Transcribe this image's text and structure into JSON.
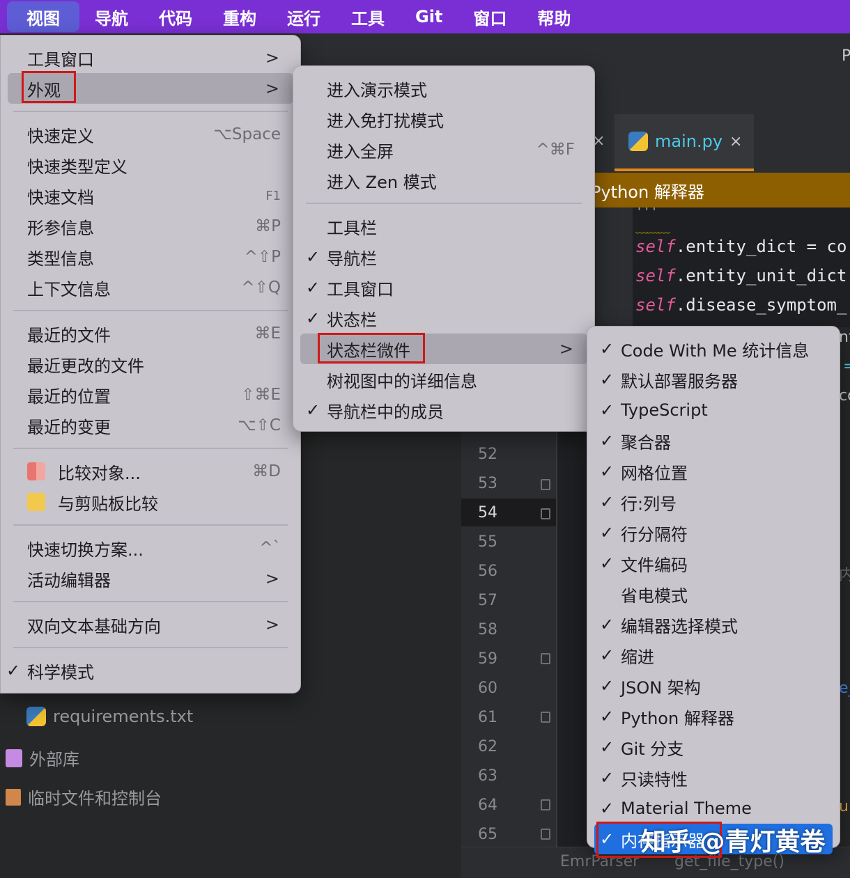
{
  "menubar": {
    "items": [
      "视图",
      "导航",
      "代码",
      "重构",
      "运行",
      "工具",
      "Git",
      "窗口",
      "帮助"
    ]
  },
  "editor": {
    "tab_label": "main.py",
    "tab_close": "×",
    "prev_tab_close": "×",
    "interpreter_banner": "Python 解释器",
    "docstring_quotes": "'''",
    "code_lines": [
      {
        "kw": "self",
        "rest": ".entity_dict = co"
      },
      {
        "kw": "self",
        "rest": ".entity_unit_dict"
      },
      {
        "kw": "self",
        "rest": ".disease_symptom_"
      }
    ],
    "line_numbers": [
      "52",
      "53",
      "54",
      "55",
      "56",
      "57",
      "58",
      "59",
      "60",
      "61",
      "62",
      "63",
      "64",
      "65"
    ],
    "current_line": "54",
    "breadcrumb_left": "EmrParser",
    "breadcrumb_right": "get_file_type()",
    "edge_chars": [
      "P",
      "nt",
      "=",
      "co",
      "内",
      "e_",
      "u"
    ]
  },
  "tree": {
    "items": [
      "requirements.txt",
      "外部库",
      "临时文件和控制台"
    ]
  },
  "view_menu": {
    "items": [
      {
        "label": "工具窗口",
        "arrow": ">"
      },
      {
        "label": "外观",
        "arrow": ">"
      },
      {
        "label": "快速定义",
        "shortcut": "⌥Space"
      },
      {
        "label": "快速类型定义"
      },
      {
        "label": "快速文档",
        "shortcut": "F1"
      },
      {
        "label": "形参信息",
        "shortcut": "⌘P"
      },
      {
        "label": "类型信息",
        "shortcut": "^⇧P"
      },
      {
        "label": "上下文信息",
        "shortcut": "^⇧Q"
      },
      {
        "label": "最近的文件",
        "shortcut": "⌘E"
      },
      {
        "label": "最近更改的文件"
      },
      {
        "label": "最近的位置",
        "shortcut": "⇧⌘E"
      },
      {
        "label": "最近的变更",
        "shortcut": "⌥⇧C"
      },
      {
        "label": "比较对象...",
        "shortcut": "⌘D"
      },
      {
        "label": "与剪贴板比较"
      },
      {
        "label": "快速切换方案...",
        "shortcut": "^`"
      },
      {
        "label": "活动编辑器",
        "arrow": ">"
      },
      {
        "label": "双向文本基础方向",
        "arrow": ">"
      },
      {
        "label": "科学模式",
        "check": "✓"
      }
    ]
  },
  "appearance_menu": {
    "items": [
      {
        "label": "进入演示模式"
      },
      {
        "label": "进入免打扰模式"
      },
      {
        "label": "进入全屏",
        "shortcut": "^⌘F"
      },
      {
        "label": "进入 Zen 模式"
      },
      {
        "label": "工具栏"
      },
      {
        "label": "导航栏",
        "check": "✓"
      },
      {
        "label": "工具窗口",
        "check": "✓"
      },
      {
        "label": "状态栏",
        "check": "✓"
      },
      {
        "label": "状态栏微件",
        "arrow": ">"
      },
      {
        "label": "树视图中的详细信息"
      },
      {
        "label": "导航栏中的成员",
        "check": "✓"
      }
    ]
  },
  "widgets_menu": {
    "items": [
      {
        "label": "Code With Me 统计信息",
        "check": "✓"
      },
      {
        "label": "默认部署服务器",
        "check": "✓"
      },
      {
        "label": "TypeScript",
        "check": "✓"
      },
      {
        "label": "聚合器",
        "check": "✓"
      },
      {
        "label": "网格位置",
        "check": "✓"
      },
      {
        "label": "行:列号",
        "check": "✓"
      },
      {
        "label": "行分隔符",
        "check": "✓"
      },
      {
        "label": "文件编码",
        "check": "✓"
      },
      {
        "label": "省电模式"
      },
      {
        "label": "编辑器选择模式",
        "check": "✓"
      },
      {
        "label": "缩进",
        "check": "✓"
      },
      {
        "label": "JSON 架构",
        "check": "✓"
      },
      {
        "label": "Python 解释器",
        "check": "✓"
      },
      {
        "label": "Git 分支",
        "check": "✓"
      },
      {
        "label": "只读特性",
        "check": "✓"
      },
      {
        "label": "Material Theme",
        "check": "✓"
      },
      {
        "label": "内存指示器",
        "check": "✓"
      }
    ]
  },
  "watermark": "知乎 @青灯黄卷",
  "colors": {
    "menubar": "#7a2fd4",
    "menu_bg": "#c8c5cd",
    "highlight_red": "#d01818",
    "selection_blue": "#1f6fe0",
    "banner": "#8e5f00"
  }
}
